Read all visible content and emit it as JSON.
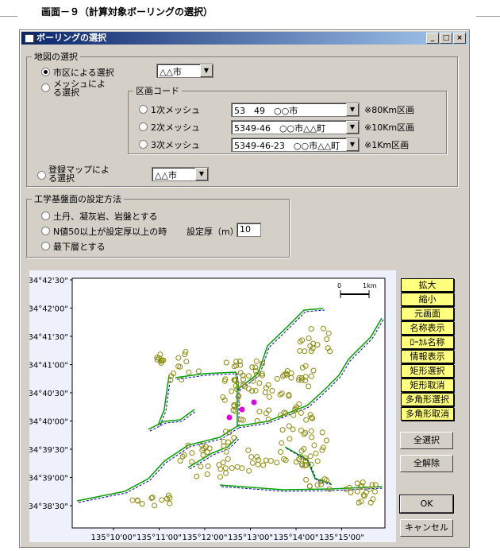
{
  "document": {
    "caption": "画面－９（計算対象ボーリングの選択）"
  },
  "window": {
    "title": "ボーリングの選択",
    "controls": [
      "_",
      "□",
      "×"
    ]
  },
  "map_select": {
    "legend": "地図の選択",
    "by_city": {
      "label": "市区による選択",
      "checked": true,
      "value": "△△市"
    },
    "by_mesh": {
      "label": "メッシュによる選択",
      "checked": false
    },
    "by_saved": {
      "label": "登録マップによる選択",
      "checked": false,
      "value": "△△市"
    },
    "section_code": {
      "legend": "区画コード",
      "rows": [
        {
          "label": "1次メッシュ",
          "value": "53　49　○○市",
          "note": "※80Km区画"
        },
        {
          "label": "2次メッシュ",
          "value": "5349-46　○○市△△町",
          "note": "※10Km区画"
        },
        {
          "label": "3次メッシュ",
          "value": "5349-46-23　○○市△△町",
          "note": "※1Km区画"
        }
      ]
    }
  },
  "base_method": {
    "legend": "工学基盤面の設定方法",
    "options": [
      {
        "label": "土丹、凝灰岩、岩盤とする"
      },
      {
        "label": "N値50以上が設定厚以上の時"
      },
      {
        "label": "最下層とする"
      }
    ],
    "thickness_label": "設定厚（m）",
    "thickness_value": "10"
  },
  "map": {
    "y_ticks": [
      "34°42'30\"",
      "34°42'00\"",
      "34°41'30\"",
      "34°41'00\"",
      "34°40'30\"",
      "34°40'00\"",
      "34°39'30\"",
      "34°39'00\"",
      "34°38'30\""
    ],
    "x_ticks": [
      "135°10'00\"",
      "135°11'00\"",
      "135°12'00\"",
      "135°13'00\"",
      "135°14'00\"",
      "135°15'00\""
    ],
    "scale": {
      "start": "0",
      "end": "1km"
    },
    "colors": {
      "plot_bg": "#ffffff",
      "frame_bg": "#eef0fb",
      "boring": "#8a8a10",
      "selected": "#e000e0",
      "road": "#00a000",
      "coast": "#0000a0"
    }
  },
  "tools": {
    "items": [
      "拡大",
      "縮小",
      "元画面",
      "名称表示",
      "ﾛｰｶﾙ名称",
      "情報表示",
      "矩形選択",
      "矩形取消",
      "多角形選択",
      "多角形取消"
    ]
  },
  "actions": {
    "select_all": "全選択",
    "clear_all": "全解除",
    "ok": "OK",
    "cancel": "キャンセル"
  }
}
